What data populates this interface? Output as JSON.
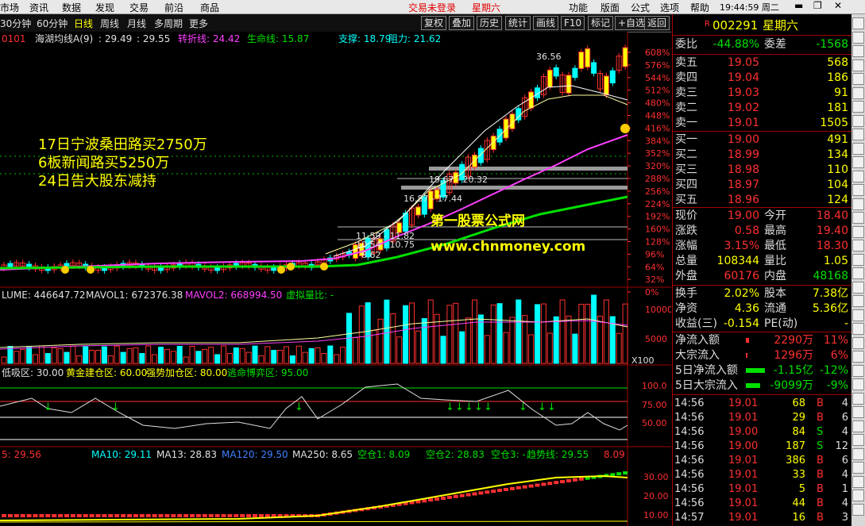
{
  "menubar": {
    "items": [
      "市场",
      "资讯",
      "数据",
      "发现",
      "交易",
      "前沿",
      "商品"
    ],
    "warning": "交易未登录",
    "weekday": "星期六",
    "items_right": [
      "功能",
      "版面",
      "公式",
      "选项",
      "帮助"
    ],
    "clock": "19:44:59 周二"
  },
  "toolbar": {
    "periods": [
      "30分钟",
      "60分钟",
      "日线",
      "周线",
      "月线",
      "多周期",
      "更多"
    ],
    "active_period": "日线",
    "buttons": [
      "复权",
      "叠加",
      "历史",
      "统计",
      "画线",
      "F10",
      "标记",
      "+自选",
      "返回"
    ]
  },
  "main": {
    "indicator_title": "0101",
    "indicator_name": "海湖均线A(9)",
    "v1": ": 29.49",
    "v2": ": 29.55",
    "turn_label": "转折线: 24.42",
    "life_label": "生命线: 15.87",
    "support_label": "支撑: 18.79",
    "resist_label": "阻力: 21.62",
    "annot1": "17日宁波桑田路买2750万",
    "annot2": "6板新闻路买5250万",
    "annot3": "24日告大股东减持",
    "watermark1": "第一股票公式网",
    "watermark2": "www.chnmoney.com",
    "peak_label": "36.56",
    "box1": "19.67 - 20.32",
    "box2": "16.87 - 17.44",
    "box3": "11.59 - 11.82",
    "box4": "10.54 - 10.75",
    "box5": "8.62",
    "pct_ticks": [
      "608%",
      "576%",
      "544%",
      "512%",
      "480%",
      "448%",
      "416%",
      "384%",
      "352%",
      "320%",
      "288%",
      "256%",
      "224%",
      "192%",
      "160%",
      "128%",
      "96%",
      "64%",
      "32%",
      "0%"
    ]
  },
  "volume": {
    "vol_label": "LUME: 446647.72",
    "mavol1": "MAVOL1: 672376.38",
    "mavol2": "MAVOL2: 668994.50",
    "virt": "虚拟量比: -",
    "ticks": [
      "10000",
      "5000"
    ],
    "unit": "X100"
  },
  "osc": {
    "l1": "低吸区: 30.00",
    "l2": "黄金建仓区: 60.00",
    "l3": "强势加仓区: 80.00",
    "l4": "逃命博弈区: 95.00",
    "ticks": [
      "100.0",
      "75.00",
      "50.00"
    ]
  },
  "ma": {
    "m1": "5: 29.56",
    "m2": "MA10: 29.11",
    "m3": "MA13: 28.83",
    "m4": "MA120: 29.50",
    "m5": "MA250: 8.65",
    "m6": "空仓1: 8.09",
    "m7": "空仓2: 28.83",
    "m8": "空仓3: -",
    "m9": "趋势线: 29.55",
    "m10": "8.09",
    "ticks": [
      "30.00",
      "20.00",
      "10.00"
    ]
  },
  "quote": {
    "code": "002291",
    "weekday": "星期六",
    "wb_label": "委比",
    "wb_val": "-44.88%",
    "wc_label": "委差",
    "wc_val": "-1568",
    "asks": [
      {
        "label": "卖五",
        "price": "19.05",
        "vol": "568"
      },
      {
        "label": "卖四",
        "price": "19.04",
        "vol": "186"
      },
      {
        "label": "卖三",
        "price": "19.03",
        "vol": "91"
      },
      {
        "label": "卖二",
        "price": "19.02",
        "vol": "181"
      },
      {
        "label": "卖一",
        "price": "19.01",
        "vol": "1505"
      }
    ],
    "bids": [
      {
        "label": "买一",
        "price": "19.00",
        "vol": "491"
      },
      {
        "label": "买二",
        "price": "18.99",
        "vol": "134"
      },
      {
        "label": "买三",
        "price": "18.98",
        "vol": "110"
      },
      {
        "label": "买四",
        "price": "18.97",
        "vol": "104"
      },
      {
        "label": "买五",
        "price": "18.96",
        "vol": "124"
      }
    ],
    "stats": [
      {
        "l1": "现价",
        "v1": "19.00",
        "l2": "今开",
        "v2": "18.40"
      },
      {
        "l1": "涨跌",
        "v1": "0.58",
        "l2": "最高",
        "v2": "19.40"
      },
      {
        "l1": "涨幅",
        "v1": "3.15%",
        "l2": "最低",
        "v2": "18.30"
      },
      {
        "l1": "总量",
        "v1": "108344",
        "l2": "量比",
        "v2": "1.05"
      },
      {
        "l1": "外盘",
        "v1": "60176",
        "l2": "内盘",
        "v2": "48168"
      }
    ],
    "stats2": [
      {
        "l1": "换手",
        "v1": "2.02%",
        "l2": "股本",
        "v2": "7.38亿"
      },
      {
        "l1": "净资",
        "v1": "4.36",
        "l2": "流通",
        "v2": "5.36亿"
      },
      {
        "l1": "收益(三)",
        "v1": "-0.154",
        "l2": "PE(动)",
        "v2": "-"
      }
    ],
    "flows": [
      {
        "l": "净流入额",
        "v": "2290万",
        "p": "11%"
      },
      {
        "l": "大宗流入",
        "v": "1296万",
        "p": "6%"
      },
      {
        "l": "5日净流入额",
        "v": "-1.15亿",
        "p": "-12%"
      },
      {
        "l": "5日大宗流入",
        "v": "-9099万",
        "p": "-9%"
      }
    ],
    "ticks": [
      {
        "t": "14:56",
        "p": "19.01",
        "v": "68",
        "s": "B",
        "n": "4"
      },
      {
        "t": "14:56",
        "p": "19.01",
        "v": "29",
        "s": "B",
        "n": "6"
      },
      {
        "t": "14:56",
        "p": "19.00",
        "v": "84",
        "s": "S",
        "n": "4"
      },
      {
        "t": "14:56",
        "p": "19.00",
        "v": "187",
        "s": "S",
        "n": "12"
      },
      {
        "t": "14:56",
        "p": "19.01",
        "v": "386",
        "s": "B",
        "n": "6"
      },
      {
        "t": "14:56",
        "p": "19.01",
        "v": "33",
        "s": "B",
        "n": "4"
      },
      {
        "t": "14:56",
        "p": "19.01",
        "v": "5",
        "s": "B",
        "n": "1"
      },
      {
        "t": "14:56",
        "p": "19.01",
        "v": "44",
        "s": "B",
        "n": "4"
      },
      {
        "t": "14:57",
        "p": "19.01",
        "v": "16",
        "s": "B",
        "n": "3"
      }
    ]
  }
}
